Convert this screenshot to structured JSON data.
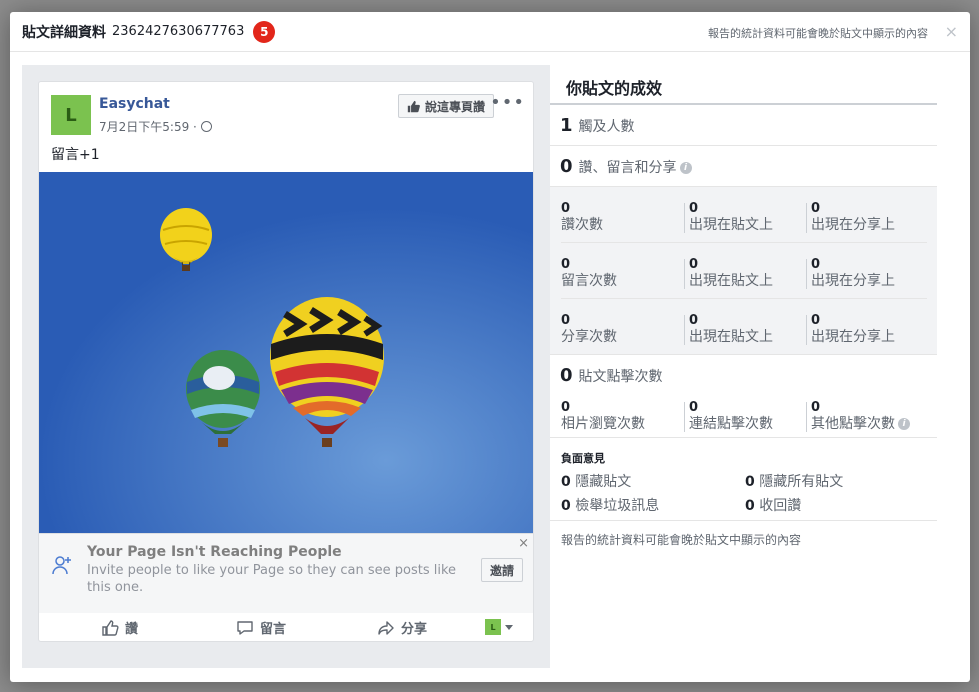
{
  "header": {
    "title": "貼文詳細資料",
    "post_id": "2362427630677763",
    "badge_count": "5",
    "note": "報告的統計資料可能會晚於貼文中顯示的內容",
    "close": "×"
  },
  "post": {
    "avatar_letter": "L",
    "page_name": "Easychat",
    "date": "7月2日下午5:59 ·",
    "like_page_label": "說這專頁讚",
    "more": "•••",
    "text": "留言+1",
    "notice": {
      "title": "Your Page Isn't Reaching People",
      "body": "Invite people to like your Page so they can see posts like this one.",
      "invite_label": "邀請",
      "close": "×"
    },
    "actions": {
      "like": "讚",
      "comment": "留言",
      "share": "分享",
      "profile_letter": "L"
    }
  },
  "stats": {
    "title": "你貼文的成效",
    "reach": {
      "value": "1",
      "label": "觸及人數"
    },
    "engagement": {
      "value": "0",
      "label": "讚、留言和分享"
    },
    "grid": [
      [
        {
          "n": "0",
          "l": "讚次數"
        },
        {
          "n": "0",
          "l": "出現在貼文上"
        },
        {
          "n": "0",
          "l": "出現在分享上"
        }
      ],
      [
        {
          "n": "0",
          "l": "留言次數"
        },
        {
          "n": "0",
          "l": "出現在貼文上"
        },
        {
          "n": "0",
          "l": "出現在分享上"
        }
      ],
      [
        {
          "n": "0",
          "l": "分享次數"
        },
        {
          "n": "0",
          "l": "出現在貼文上"
        },
        {
          "n": "0",
          "l": "出現在分享上"
        }
      ]
    ],
    "clicks": {
      "value": "0",
      "label": "貼文點擊次數"
    },
    "click_grid": [
      {
        "n": "0",
        "l": "相片瀏覽次數"
      },
      {
        "n": "0",
        "l": "連結點擊次數"
      },
      {
        "n": "0",
        "l": "其他點擊次數"
      }
    ],
    "negative": {
      "title": "負面意見",
      "hide_post": {
        "n": "0",
        "l": "隱藏貼文"
      },
      "hide_all": {
        "n": "0",
        "l": "隱藏所有貼文"
      },
      "spam": {
        "n": "0",
        "l": "檢舉垃圾訊息"
      },
      "unlike": {
        "n": "0",
        "l": "收回讚"
      }
    },
    "footer_note": "報告的統計資料可能會晚於貼文中顯示的內容"
  },
  "colors": {
    "brand_blue": "#385898",
    "badge_red": "#e2261a",
    "avatar_green": "#7bc24f"
  }
}
